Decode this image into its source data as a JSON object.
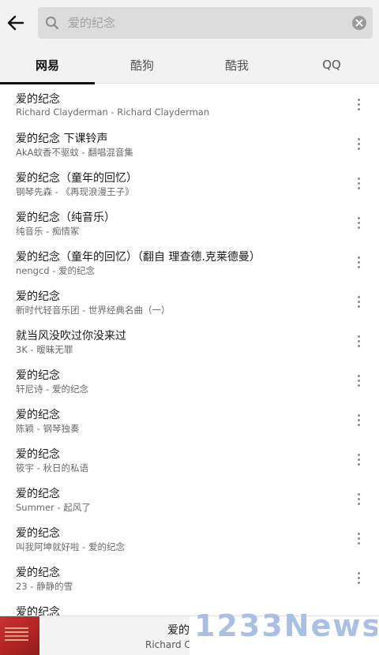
{
  "search": {
    "placeholder": "爱的纪念"
  },
  "tabs": [
    {
      "label": "网易",
      "active": true
    },
    {
      "label": "酷狗",
      "active": false
    },
    {
      "label": "酷我",
      "active": false
    },
    {
      "label": "QQ",
      "active": false
    }
  ],
  "songs": [
    {
      "title": "爱的纪念",
      "subtitle": "Richard Clayderman - Richard Clayderman"
    },
    {
      "title": "爱的纪念 下课铃声",
      "subtitle": "AkA蚊香不驱蚊 - 翻唱混音集"
    },
    {
      "title": "爱的纪念（童年的回忆）",
      "subtitle": "钢琴先森 - 《再现浪漫王子》"
    },
    {
      "title": "爱的纪念（纯音乐）",
      "subtitle": "纯音乐 - 痴情冢"
    },
    {
      "title": "爱的纪念（童年的回忆）（翻自 理查德.克莱德曼）",
      "subtitle": "nengcd - 爱的纪念"
    },
    {
      "title": "爱的纪念",
      "subtitle": "新时代轻音乐团 - 世界经典名曲（一）"
    },
    {
      "title": "就当风没吹过你没来过",
      "subtitle": "3K - 暧昧无罪"
    },
    {
      "title": "爱的纪念",
      "subtitle": "轩尼诗 - 爱的纪念"
    },
    {
      "title": "爱的纪念",
      "subtitle": "陈颖 - 钢琴独奏"
    },
    {
      "title": "爱的纪念",
      "subtitle": "筱宇 - 秋日的私语"
    },
    {
      "title": "爱的纪念",
      "subtitle": "Summer - 起风了"
    },
    {
      "title": "爱的纪念",
      "subtitle": "叫我阿坤就好啦 - 爱的纪念"
    },
    {
      "title": "爱的纪念",
      "subtitle": "23 - 静静的雪"
    },
    {
      "title": "爱的纪念",
      "subtitle": ""
    }
  ],
  "player": {
    "title": "爱的",
    "artist": "Richard Cl"
  },
  "watermark": {
    "text": "1233News"
  },
  "colors": {
    "watermark": "#a9bfe6",
    "album_art": "#c8332e"
  },
  "icons": {
    "back": "arrow-left",
    "search": "magnifier",
    "clear": "circle-x",
    "more": "vertical-ellipsis"
  }
}
